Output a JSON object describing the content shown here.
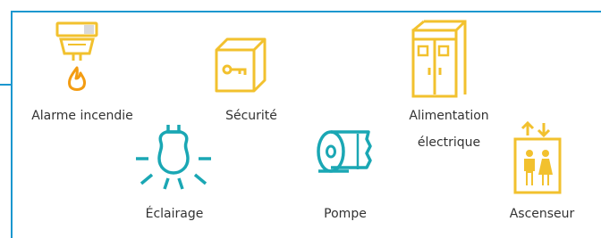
{
  "colors": {
    "frame": "#1b97cf",
    "accent_yellow": "#f2c12e",
    "accent_orange": "#f39c12",
    "accent_teal": "#1aa7b4",
    "text": "#333333"
  },
  "items": [
    {
      "label": "Alarme incendie",
      "icon": "fire-alarm-icon"
    },
    {
      "label": "Sécurité",
      "icon": "safe-key-icon"
    },
    {
      "label": "Alimentation",
      "label2": "électrique",
      "icon": "electrical-cabinet-icon"
    },
    {
      "label": "Éclairage",
      "icon": "light-bulb-icon"
    },
    {
      "label": "Pompe",
      "icon": "pump-icon"
    },
    {
      "label": "Ascenseur",
      "icon": "elevator-icon"
    }
  ]
}
